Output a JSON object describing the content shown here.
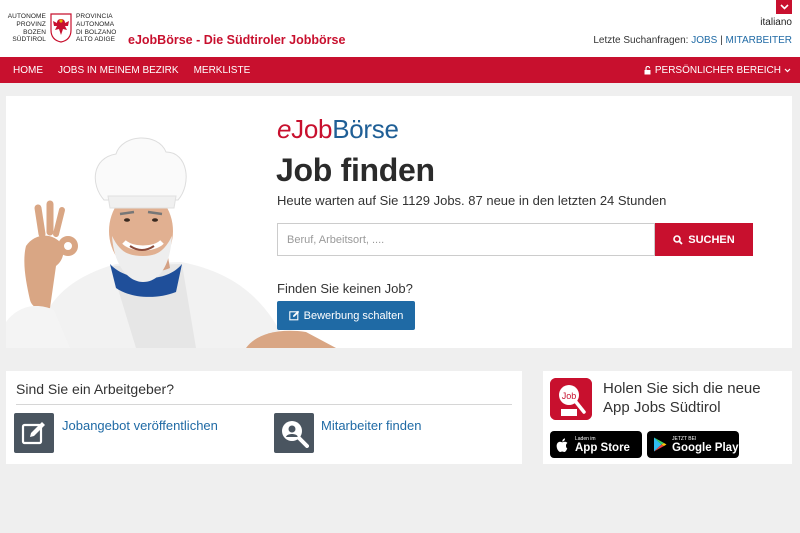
{
  "header": {
    "logo_left_lines": [
      "AUTONOME",
      "PROVINZ",
      "BOZEN",
      "SÜDTIROL"
    ],
    "logo_right_lines": [
      "PROVINCIA",
      "AUTONOMA",
      "DI BOLZANO",
      "ALTO ADIGE"
    ],
    "site_title": "eJobBörse - Die Südtiroler Jobbörse",
    "language_link": "italiano",
    "recent_searches_label": "Letzte Suchanfragen:",
    "recent_jobs_link": "JOBS",
    "recent_separator": "|",
    "recent_employees_link": "MITARBEITER"
  },
  "nav": {
    "items": [
      "HOME",
      "JOBS IN MEINEM BEZIRK",
      "MERKLISTE"
    ],
    "personal_area": "PERSÖNLICHER BEREICH"
  },
  "hero": {
    "brand_e": "e",
    "brand_job": "Job",
    "brand_rest": "Börse",
    "title": "Job finden",
    "subtitle": "Heute warten auf Sie 1129 Jobs. 87 neue in den letzten 24 Stunden",
    "search_placeholder": "Beruf, Arbeitsort, ....",
    "search_button": "SUCHEN",
    "no_job_text": "Finden Sie keinen Job?",
    "apply_button": "Bewerbung schalten"
  },
  "employer": {
    "title": "Sind Sie ein Arbeitgeber?",
    "publish_link": "Jobangebot veröffentlichen",
    "find_link": "Mitarbeiter finden"
  },
  "app": {
    "line1": "Holen Sie sich die neue",
    "line2": "App Jobs Südtirol",
    "icon_label": "Job",
    "appstore_small": "Laden im",
    "appstore_big": "App Store",
    "googleplay_small": "JETZT BEI",
    "googleplay_big": "Google Play"
  },
  "colors": {
    "brand_red": "#c8102e",
    "brand_blue": "#1f6aa5",
    "icon_gray": "#4a5560"
  }
}
